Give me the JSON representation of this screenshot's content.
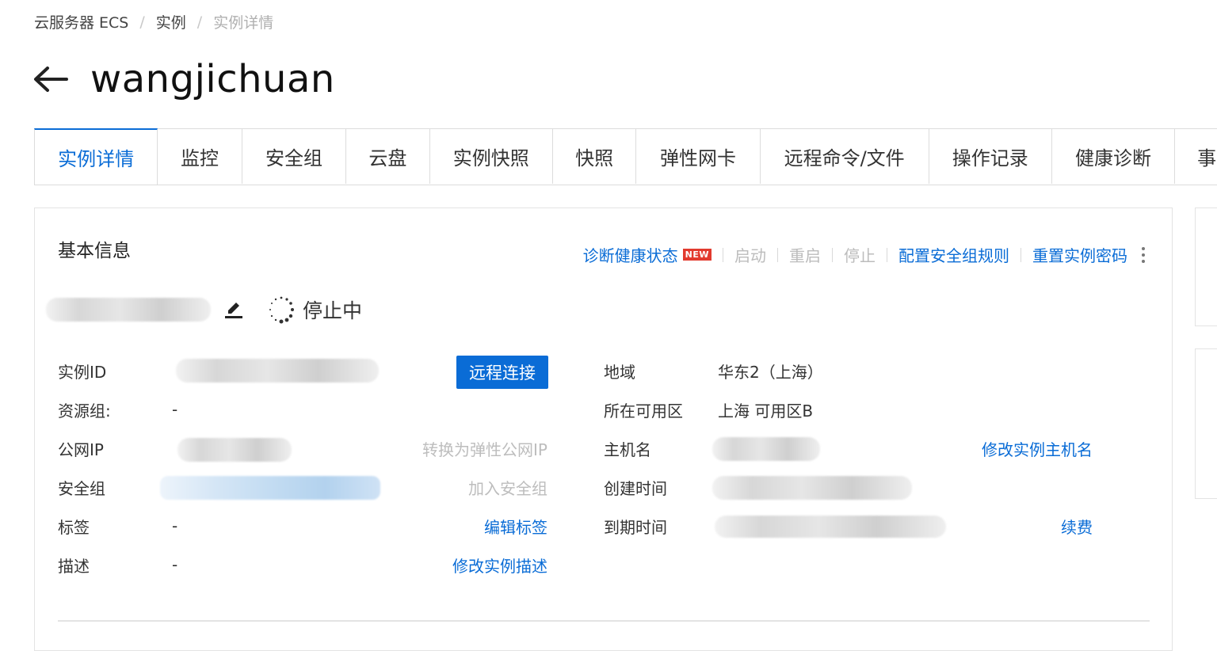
{
  "breadcrumb": [
    "云服务器 ECS",
    "实例",
    "实例详情"
  ],
  "breadcrumb_sep": "/",
  "page_title": "wangjichuan",
  "tabs": [
    "实例详情",
    "监控",
    "安全组",
    "云盘",
    "实例快照",
    "快照",
    "弹性网卡",
    "远程命令/文件",
    "操作记录",
    "健康诊断",
    "事"
  ],
  "active_tab": 0,
  "card": {
    "title": "基本信息",
    "actions": {
      "diagnose": "诊断健康状态",
      "new_badge": "NEW",
      "start": "启动",
      "restart": "重启",
      "stop": "停止",
      "config_sg": "配置安全组规则",
      "reset_pwd": "重置实例密码"
    },
    "status": "停止中",
    "left": {
      "instance_id_label": "实例ID",
      "remote_connect": "远程连接",
      "resource_group_label": "资源组:",
      "resource_group_value": "-",
      "public_ip_label": "公网IP",
      "convert_eip": "转换为弹性公网IP",
      "security_group_label": "安全组",
      "join_sg": "加入安全组",
      "tags_label": "标签",
      "tags_value": "-",
      "edit_tags": "编辑标签",
      "desc_label": "描述",
      "desc_value": "-",
      "edit_desc": "修改实例描述"
    },
    "right": {
      "region_label": "地域",
      "region_value": "华东2（上海）",
      "zone_label": "所在可用区",
      "zone_value": "上海 可用区B",
      "hostname_label": "主机名",
      "edit_hostname": "修改实例主机名",
      "created_label": "创建时间",
      "expire_label": "到期时间",
      "renew": "续费"
    }
  },
  "colors": {
    "accent": "#0a6cd6",
    "badge": "#e23a2e",
    "disabled": "#bdbdbd"
  }
}
